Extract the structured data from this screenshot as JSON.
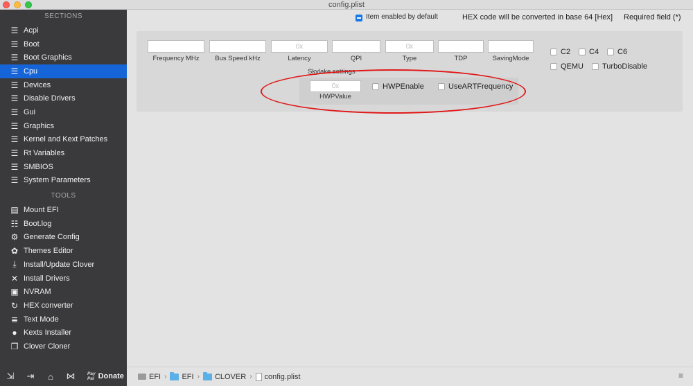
{
  "window": {
    "title": "config.plist"
  },
  "sidebar": {
    "sections_header": "SECTIONS",
    "sections": [
      {
        "label": "Acpi",
        "icon": "list-icon"
      },
      {
        "label": "Boot",
        "icon": "list-icon"
      },
      {
        "label": "Boot Graphics",
        "icon": "list-icon"
      },
      {
        "label": "Cpu",
        "icon": "list-icon",
        "active": true
      },
      {
        "label": "Devices",
        "icon": "list-icon"
      },
      {
        "label": "Disable Drivers",
        "icon": "list-icon"
      },
      {
        "label": "Gui",
        "icon": "list-icon"
      },
      {
        "label": "Graphics",
        "icon": "list-icon"
      },
      {
        "label": "Kernel and Kext Patches",
        "icon": "list-icon"
      },
      {
        "label": "Rt Variables",
        "icon": "list-icon"
      },
      {
        "label": "SMBIOS",
        "icon": "list-icon"
      },
      {
        "label": "System Parameters",
        "icon": "list-icon"
      }
    ],
    "tools_header": "TOOLS",
    "tools": [
      {
        "label": "Mount EFI",
        "icon": "drive-icon"
      },
      {
        "label": "Boot.log",
        "icon": "log-icon"
      },
      {
        "label": "Generate Config",
        "icon": "gears-icon"
      },
      {
        "label": "Themes Editor",
        "icon": "palette-icon"
      },
      {
        "label": "Install/Update Clover",
        "icon": "download-icon"
      },
      {
        "label": "Install Drivers",
        "icon": "tools-icon"
      },
      {
        "label": "NVRAM",
        "icon": "chip-icon"
      },
      {
        "label": "HEX converter",
        "icon": "refresh-icon"
      },
      {
        "label": "Text Mode",
        "icon": "text-icon"
      },
      {
        "label": "Kexts Installer",
        "icon": "kext-icon"
      },
      {
        "label": "Clover Cloner",
        "icon": "clone-icon"
      }
    ],
    "bottom": {
      "paypal_line1": "Pay",
      "paypal_line2": "Pal",
      "donate_label": "Donate"
    }
  },
  "header": {
    "legend_text": "Item enabled by default",
    "hex_note": "HEX code will be converted in base 64 [Hex]",
    "required_note": "Required field (*)"
  },
  "cpu": {
    "fields": [
      {
        "label": "Frequency MHz",
        "placeholder": ""
      },
      {
        "label": "Bus Speed kHz",
        "placeholder": ""
      },
      {
        "label": "Latency",
        "placeholder": "0x"
      },
      {
        "label": "QPI",
        "placeholder": ""
      },
      {
        "label": "Type",
        "placeholder": "0x"
      },
      {
        "label": "TDP",
        "placeholder": ""
      },
      {
        "label": "SavingMode",
        "placeholder": ""
      }
    ],
    "checkboxes": [
      {
        "label": "C2",
        "checked": false
      },
      {
        "label": "C4",
        "checked": false
      },
      {
        "label": "C6",
        "checked": false
      },
      {
        "label": "QEMU",
        "checked": false
      },
      {
        "label": "TurboDisable",
        "checked": false
      }
    ],
    "skylake": {
      "title": "Skylake settings",
      "hwp_value_label": "HWPValue",
      "hwp_value_placeholder": "0x",
      "hwp_enable_label": "HWPEnable",
      "use_art_label": "UseARTFrequency"
    }
  },
  "pathbar": {
    "crumbs": [
      "EFI",
      "EFI",
      "CLOVER",
      "config.plist"
    ]
  },
  "colors": {
    "accent": "#1565d8",
    "annotation": "#e01818",
    "sidebar_bg": "#3a3a3c"
  }
}
